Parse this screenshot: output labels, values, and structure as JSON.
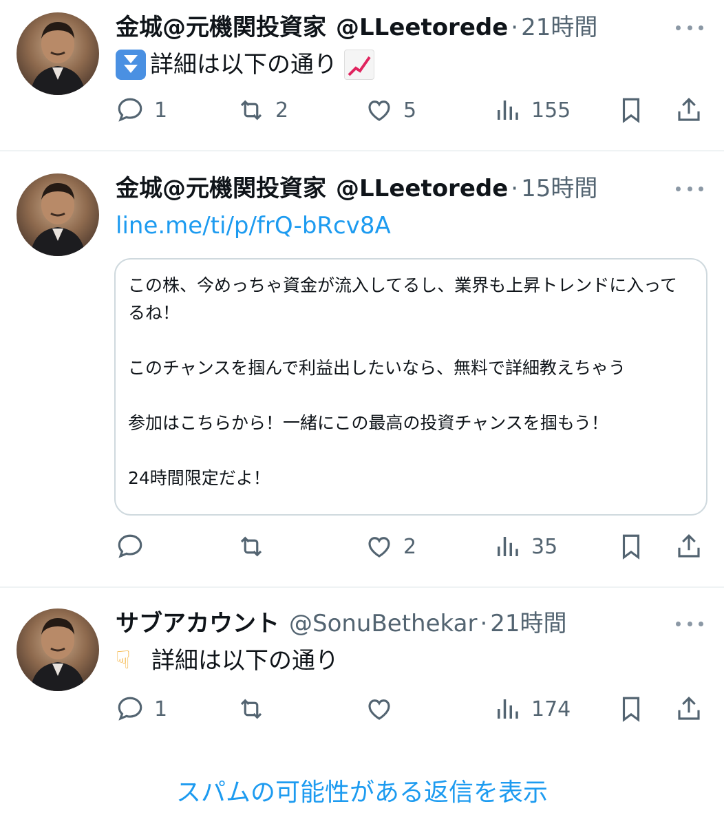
{
  "tweets": [
    {
      "display_name": "金城@元機関投資家",
      "handle": "@LLeetorede",
      "separator": "·",
      "time": "21時間",
      "text": "詳細は以下の通り",
      "actions": {
        "reply": "1",
        "retweet": "2",
        "like": "5",
        "views": "155"
      }
    },
    {
      "display_name": "金城@元機関投資家",
      "handle": "@LLeetorede",
      "separator": "·",
      "time": "15時間",
      "link": "line.me/ti/p/frQ-bRcv8A",
      "card_lines": [
        "この株、今めっちゃ資金が流入してるし、業界も上昇トレンドに入って",
        "るね！",
        "このチャンスを掴んで利益出したいなら、無料で詳細教えちゃう",
        "参加はこちらから！一緒にこの最高の投資チャンスを掴もう！",
        "24時間限定だよ！"
      ],
      "actions": {
        "reply": "",
        "retweet": "",
        "like": "2",
        "views": "35"
      }
    },
    {
      "display_name": "サブアカウント",
      "handle": "@SonuBethekar",
      "separator": "·",
      "time": "21時間",
      "text": "詳細は以下の通り",
      "actions": {
        "reply": "1",
        "retweet": "",
        "like": "",
        "views": "174"
      }
    }
  ],
  "spam_link": "スパムの可能性がある返信を表示",
  "icons": [
    "avatar",
    "more-icon",
    "reply-icon",
    "retweet-icon",
    "like-icon",
    "views-icon",
    "bookmark-icon",
    "share-icon"
  ],
  "colors": {
    "link": "#1d9bf0",
    "muted": "#536471",
    "border": "#cfd9de"
  }
}
